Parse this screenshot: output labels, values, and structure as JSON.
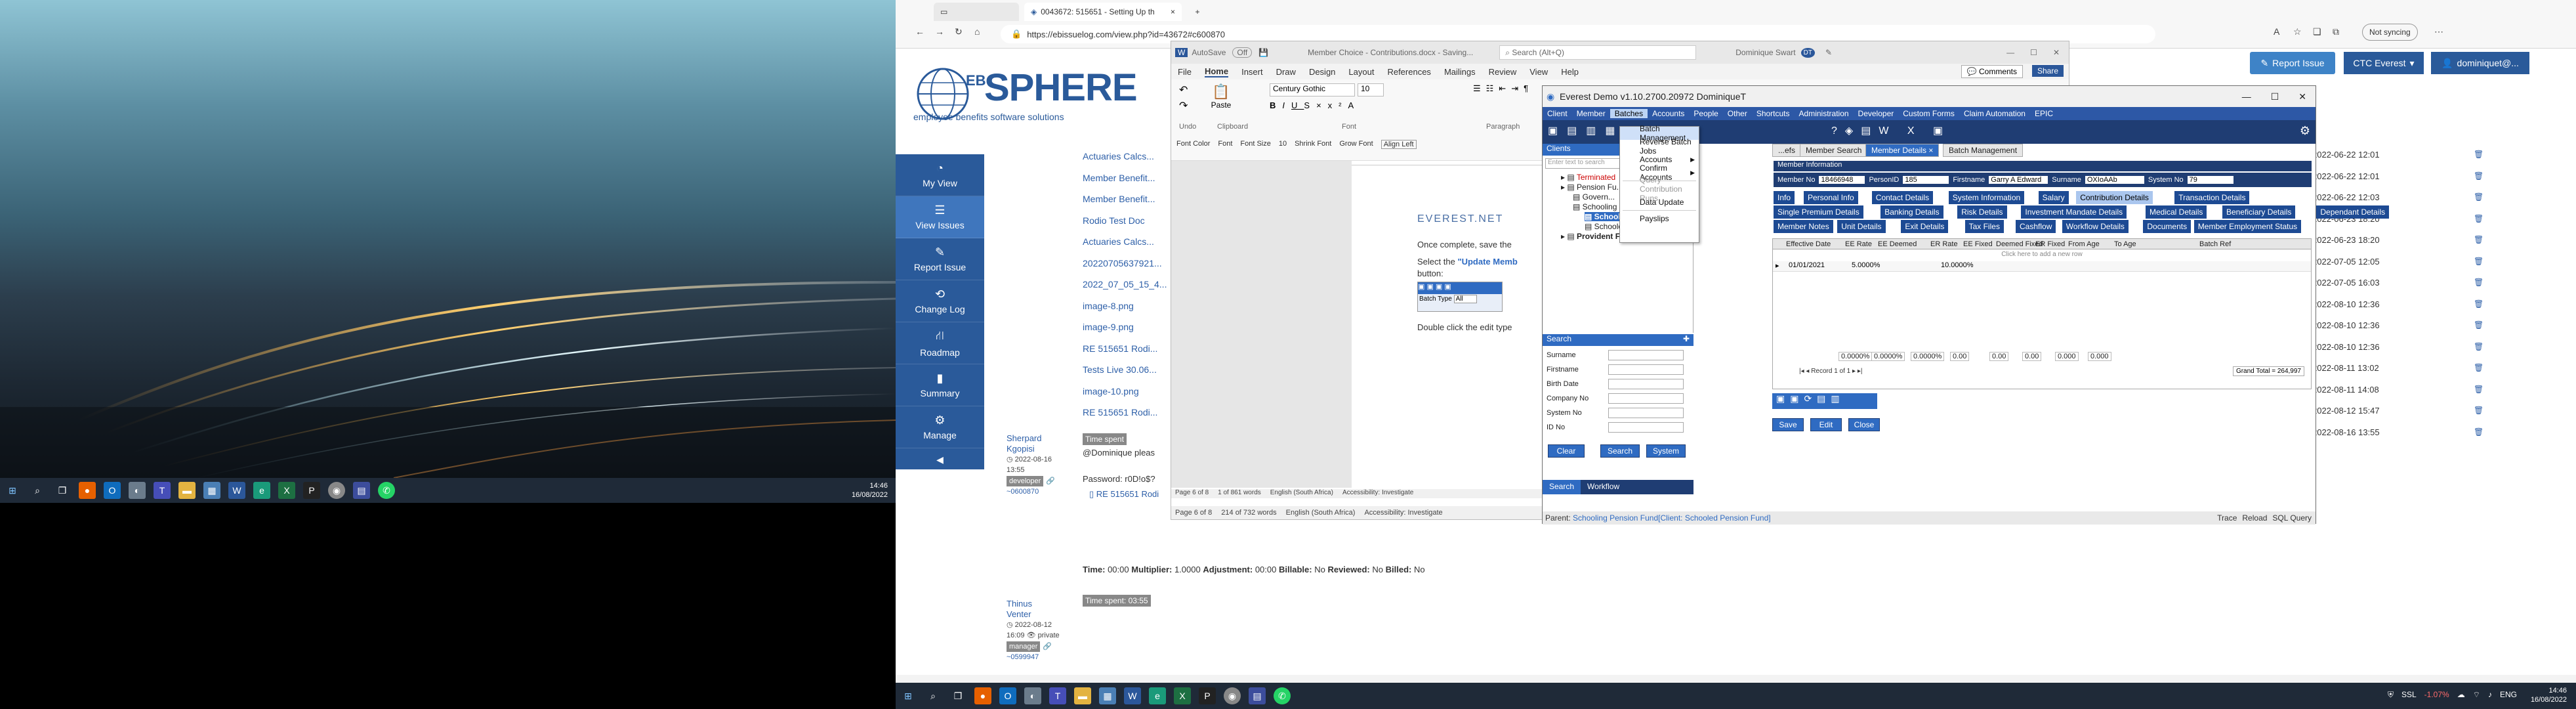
{
  "left_monitor": {
    "taskbar": {
      "time": "14:46",
      "date": "16/08/2022"
    }
  },
  "browser": {
    "tab_title": "0043672: 515651 - Setting Up th",
    "address": "https://ebissuelog.com/view.php?id=43672#c600870",
    "not_syncing": "Not syncing"
  },
  "ebsphere": {
    "logo_eb": "EB",
    "logo_sphere": "SPHERE",
    "logo_tagline": "employee benefits software solutions",
    "report_issue": "Report Issue",
    "company": "CTC Everest",
    "user": "dominiquet@...",
    "nav": [
      {
        "label": "My View",
        "icon": "dashboard-icon"
      },
      {
        "label": "View Issues",
        "icon": "list-icon"
      },
      {
        "label": "Report Issue",
        "icon": "edit-icon"
      },
      {
        "label": "Change Log",
        "icon": "retweet-icon"
      },
      {
        "label": "Roadmap",
        "icon": "road-icon"
      },
      {
        "label": "Summary",
        "icon": "chart-icon"
      },
      {
        "label": "Manage",
        "icon": "gears-icon"
      }
    ],
    "attachments": [
      "Actuaries Calcs...",
      "Member Benefit...",
      "Member Benefit...",
      "Rodio Test Doc",
      "Actuaries Calcs...",
      "20220705637921...",
      "2022_07_05_15_4...",
      "image-8.png",
      "image-9.png",
      "RE 515651 Rodi...",
      "Tests Live 30.06...",
      "image-10.png",
      "RE 515651 Rodi..."
    ],
    "dates": [
      "2022-06-22 12:01",
      "2022-06-22 12:01",
      "2022-06-22 12:03",
      "2022-06-23 18:20",
      "2022-06-23 18:20",
      "2022-07-05 12:05",
      "2022-07-05 16:03",
      "2022-08-10 12:36",
      "2022-08-10 12:36",
      "2022-08-10 12:36",
      "2022-08-11 13:02",
      "2022-08-11 14:08",
      "2022-08-12 15:47",
      "2022-08-16 13:55"
    ],
    "comment1": {
      "author_first": "Sherpard",
      "author_last": "Kgopisi",
      "date": "2022-08-16",
      "time": "13:55",
      "role": "developer",
      "id": "~0600870",
      "time_spent": "Time spent",
      "text1": "@Dominique pleas",
      "text2": "Password: r0D!o$?",
      "attachment": "RE 515651 Rodi"
    },
    "time_line": {
      "label": "Time:",
      "time": "00:00",
      "mult_label": "Multiplier:",
      "mult": "1.0000",
      "adj_label": "Adjustment:",
      "adj": "00:00",
      "bill_label": "Billable:",
      "bill": "No",
      "rev_label": "Reviewed:",
      "rev": "No",
      "billed_label": "Billed:",
      "billed": "No"
    },
    "comment2": {
      "time_spent": "Time spent: 03:55",
      "author_first": "Thinus",
      "author_last": "Venter",
      "date": "2022-08-12",
      "time": "16:09",
      "privacy": "private",
      "role": "manager",
      "id": "~0599947"
    }
  },
  "word": {
    "autosave": "AutoSave",
    "autosave_state": "Off",
    "doc_title": "Member Choice - Contributions.docx - Saving...",
    "search_placeholder": "Search (Alt+Q)",
    "user": "Dominique Swart",
    "user_initials": "DT",
    "comments": "Comments",
    "share": "Share",
    "menu": [
      "File",
      "Home",
      "Insert",
      "Draw",
      "Design",
      "Layout",
      "References",
      "Mailings",
      "Review",
      "View",
      "Help"
    ],
    "font_name": "Century Gothic",
    "font_size": "10",
    "groups": [
      "Undo",
      "Clipboard",
      "Font",
      "Paragraph"
    ],
    "paste": "Paste",
    "quick": [
      "Font Color",
      "Font",
      "Font Size",
      "10",
      "Shrink Font",
      "Grow Font",
      "Align Left"
    ],
    "doc_brand": "EVEREST.NET",
    "doc_line1": "Once complete, save the",
    "doc_line2a": "Select the ",
    "doc_line2b": "\"Update Memb",
    "doc_line3": "button:",
    "doc_batch_type": "Batch Type",
    "doc_batch_val": "All",
    "doc_line4": "Double click the edit type",
    "status1": {
      "page": "Page 6 of 8",
      "words": "1 of 861 words",
      "lang": "English (South Africa)",
      "access": "Accessibility: Investigate"
    },
    "status2": {
      "page": "Page 6 of 8",
      "words": "214 of 732 words",
      "lang": "English (South Africa)",
      "access": "Accessibility: Investigate"
    }
  },
  "everest": {
    "title": "Everest Demo v1.10.2700.20972 DominiqueT",
    "menu": [
      "Client",
      "Member",
      "Batches",
      "Accounts",
      "People",
      "Other",
      "Shortcuts",
      "Administration",
      "Developer",
      "Custom Forms",
      "Claim Automation",
      "EPIC"
    ],
    "batch_menu": [
      {
        "label": "Batch Management",
        "state": "hl"
      },
      {
        "label": "Reverse Batch Jobs",
        "state": ""
      },
      {
        "label": "Accounts",
        "state": "",
        "sub": true
      },
      {
        "label": "Confirm Accounts",
        "state": "",
        "sub": true
      },
      {
        "label": "Query Contribution Runs",
        "state": "dis"
      },
      {
        "label": "Data Update",
        "state": ""
      },
      {
        "label": "Payslips",
        "state": ""
      }
    ],
    "clients_header": "Clients",
    "filter_placeholder": "Enter text to search",
    "tree": [
      {
        "label": "Terminated",
        "level": 1,
        "color": "#c00"
      },
      {
        "label": "Pension Fu...",
        "level": 1
      },
      {
        "label": "Govern...",
        "level": 2
      },
      {
        "label": "Schooling Pension Fund (6)",
        "level": 2
      },
      {
        "label": "Schooled Pension Fund",
        "level": 3,
        "selected": true
      },
      {
        "label": "Schooled Pensioners (2)",
        "level": 3
      },
      {
        "label": "Provident Fund",
        "level": 1,
        "bold": true
      }
    ],
    "search_header": "Search",
    "search_fields": [
      "Surname",
      "Firstname",
      "Birth Date",
      "Company No",
      "System No",
      "ID No"
    ],
    "search_buttons": [
      "Clear",
      "Search",
      "System"
    ],
    "bottom_tabs": [
      "Search",
      "Workflow"
    ],
    "doc_tabs": [
      "...efs",
      "Member Search",
      "Member Details",
      "Batch Management"
    ],
    "member_info_header": "Member Information",
    "member_no_label": "Member No",
    "member_no": "18466948",
    "person_id_label": "PersonID",
    "person_id": "185",
    "firstname_label": "Firstname",
    "firstname": "Garry A Edward",
    "surname_label": "Surname",
    "surname": "OXIoAAb",
    "system_no_label": "System No",
    "system_no": "79",
    "subtabs_row1": [
      "Info",
      "Personal Info",
      "Contact Details",
      "System Information",
      "Salary",
      "Contribution Details",
      "Transaction Details"
    ],
    "subtabs_row2": [
      "Single Premium Details",
      "Banking Details",
      "Risk Details",
      "Investment Mandate Details",
      "Medical Details",
      "Beneficiary Details",
      "Dependant Details"
    ],
    "subtabs_row3": [
      "Member Notes",
      "Unit Details",
      "Exit Details",
      "Tax Files",
      "Cashflow",
      "Workflow Details",
      "Documents",
      "Member Employment Status"
    ],
    "grid_columns": [
      "Effective Date",
      "EE Rate",
      "EE Deemed",
      "ER Rate",
      "EE Fixed",
      "Deemed Fixed",
      "ER Fixed",
      "From Age",
      "To Age",
      "Batch Ref"
    ],
    "grid_placeholder": "Click here to add a new row",
    "row": {
      "date": "01/01/2021",
      "ee_rate": "5.0000%",
      "er_rate": "10.0000%"
    },
    "totals": [
      "0.0000%",
      "0.0000%",
      "0.0000%",
      "0.00",
      "0.00",
      "0.00",
      "0.000",
      "0.000"
    ],
    "record": "Record 1 of 1",
    "grand_total": "Grand Total = 264,997",
    "action_buttons": [
      "Save",
      "Edit",
      "Close"
    ],
    "status_left_label": "Parent:",
    "status_left": "Schooling Pension Fund",
    "status_client_label": "[Client:",
    "status_client": "Schooled Pension Fund]",
    "status_right": [
      "Trace",
      "Reload",
      "SQL Query"
    ]
  },
  "taskbar_right": {
    "time": "14:46",
    "date": "16/08/2022",
    "ssl": "SSL",
    "pct": "-1.07%",
    "lang": "ENG"
  }
}
